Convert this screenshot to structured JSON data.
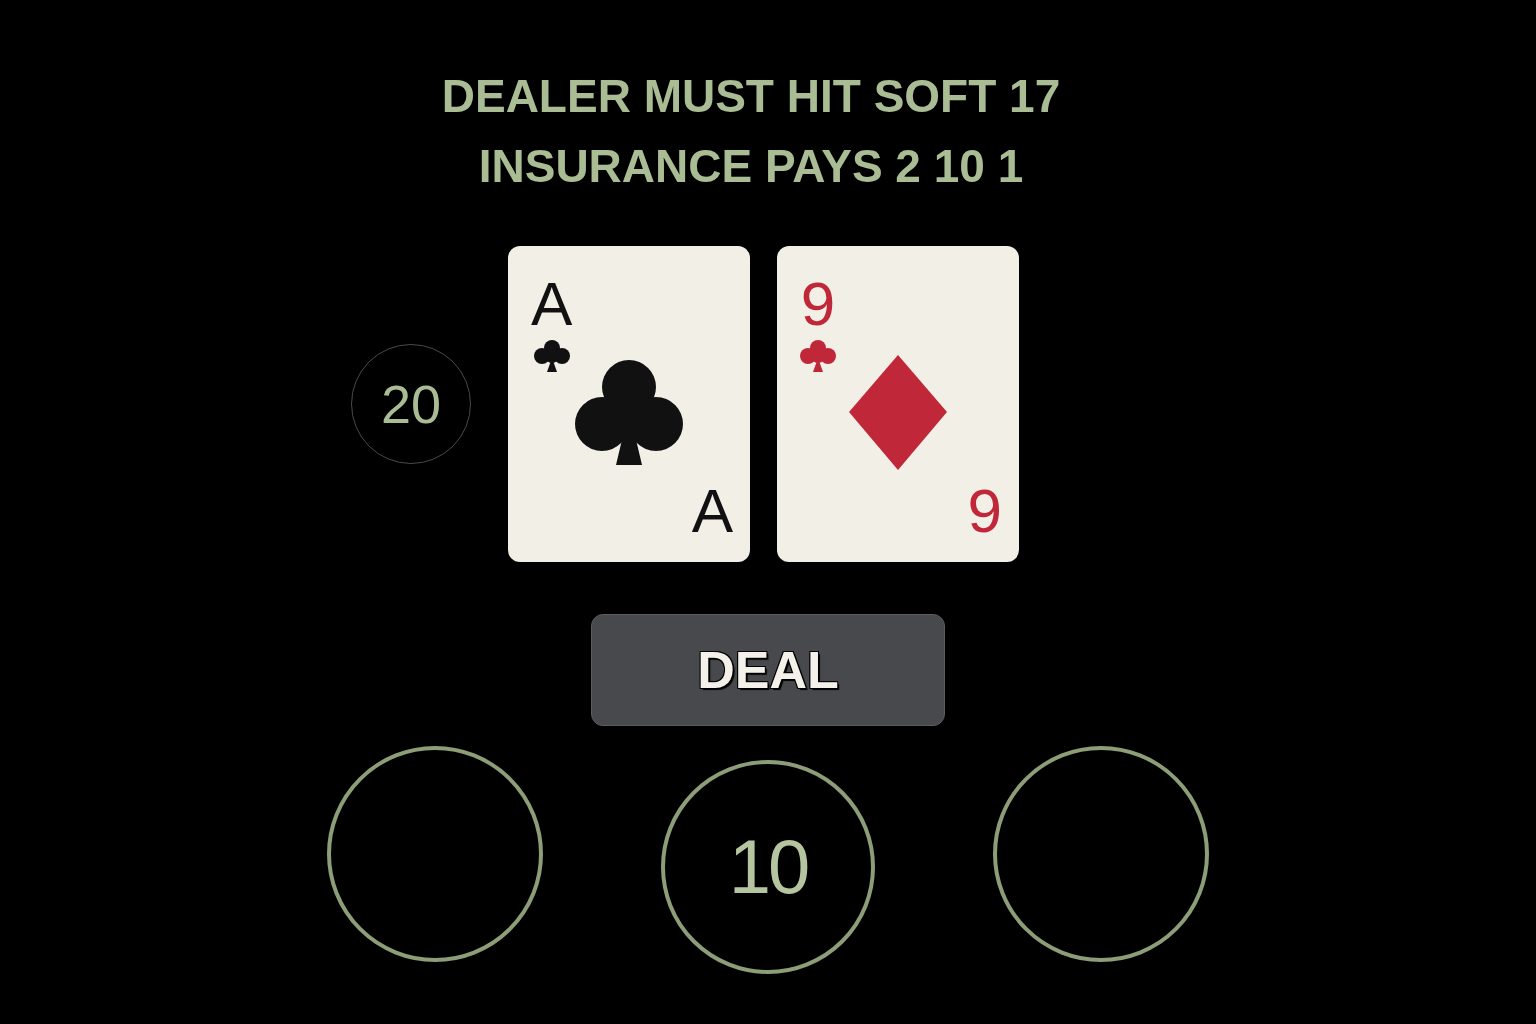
{
  "rules": [
    "DEALER MUST HIT SOFT 17",
    "INSURANCE PAYS 2 10 1"
  ],
  "hand_total": "20",
  "cards": [
    {
      "kind": "club",
      "top_rank": "A",
      "bottom_rank": "A",
      "color": "#111111"
    },
    {
      "kind": "diamond",
      "top_rank": "9",
      "bottom_rank": "9",
      "color": "#c0283a"
    }
  ],
  "deal_button": {
    "label": "DEAL"
  },
  "bet_spots": [
    {
      "kind": "empty"
    },
    {
      "kind": "bet",
      "amount": "10"
    },
    {
      "kind": "empty"
    }
  ]
}
